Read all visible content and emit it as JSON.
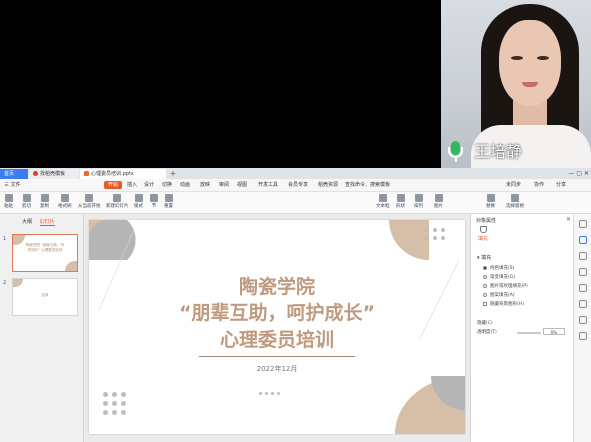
{
  "video": {
    "speaker_name": "王培静"
  },
  "app": {
    "tabs": [
      {
        "label": "首页"
      },
      {
        "label": "找稻壳模板"
      },
      {
        "label": "心理委员培训.pptx"
      }
    ],
    "menu": [
      "三 文件",
      "开始",
      "插入",
      "设计",
      "切换",
      "动画",
      "放映",
      "审阅",
      "视图",
      "开发工具",
      "会员专享",
      "稻壳资源",
      "查找命令、搜索模板"
    ],
    "menu_active": "开始",
    "menu_right": [
      "未同步",
      "协作",
      "分享"
    ],
    "ribbon": [
      "粘贴",
      "剪切",
      "复制",
      "格式刷",
      "从当前开始",
      "新建幻灯片",
      "版式",
      "节",
      "重置",
      "文本框",
      "形状",
      "排列",
      "图片",
      "替换",
      "选择窗格"
    ],
    "left_panel": {
      "tabs": [
        "大纲",
        "幻灯片"
      ],
      "slides": [
        {
          "num": "1",
          "text": "陶瓷学院 “朋辈互助，呵护成长” 心理委员培训"
        },
        {
          "num": "2",
          "text": "目录"
        }
      ]
    },
    "slide": {
      "title1": "陶瓷学院",
      "title2": "“朋辈互助，呵护成长”",
      "title3": "心理委员培训",
      "date": "2022年12月"
    },
    "right_pane": {
      "title": "对象属性",
      "tab": "填充",
      "section": "填充",
      "options": [
        "纯色填充(S)",
        "渐变填充(G)",
        "图片或纹理填充(P)",
        "图案填充(A)",
        "隐藏背景图形(H)"
      ],
      "hidden_label": "隐藏(C)",
      "transparency_label": "透明度(T)",
      "transparency_value": "0%"
    },
    "colors": {
      "accent": "#e65b2a",
      "title_brown": "#bf9a7e",
      "blob_tan": "#d6bfa8",
      "blob_grey": "#b5b5b5",
      "mic_green": "#2dbb5c"
    }
  }
}
